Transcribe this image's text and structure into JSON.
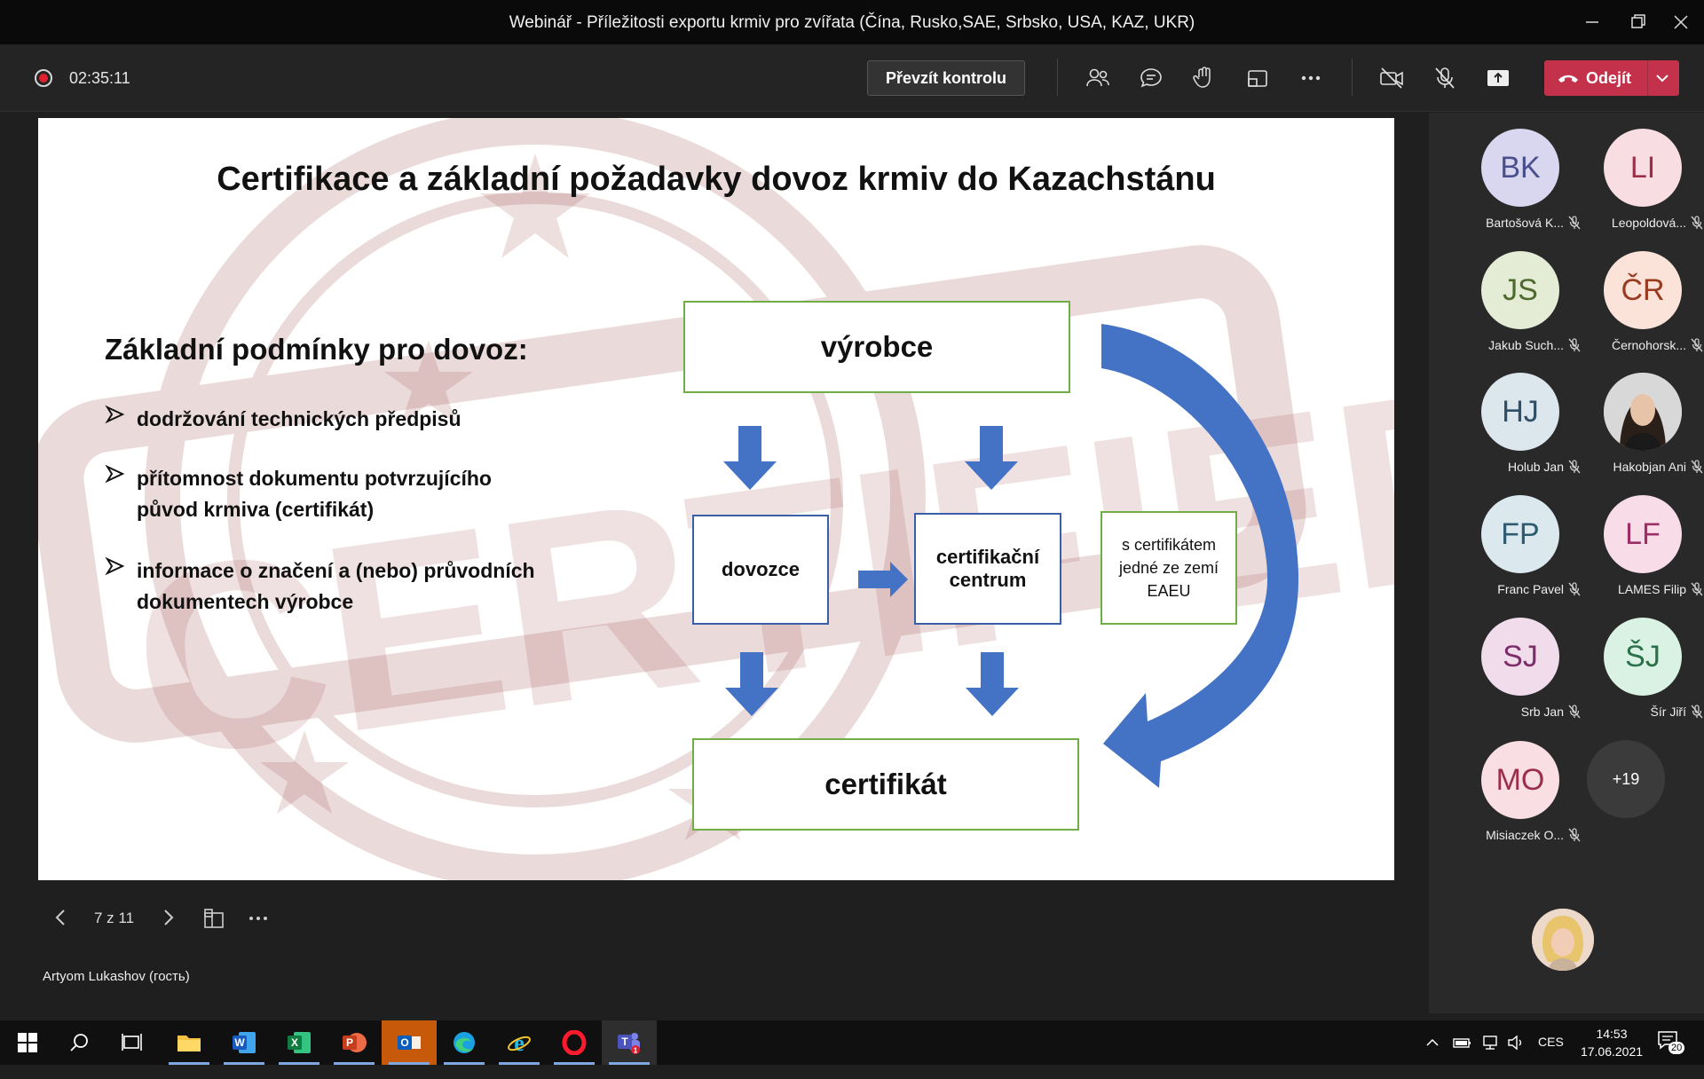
{
  "window": {
    "title": "Webinář - Příležitosti exportu krmiv pro zvířata (Čína, Rusko,SAE, Srbsko, USA, KAZ, UKR)"
  },
  "toolbar": {
    "timer": "02:35:11",
    "take_control_label": "Převzít kontrolu",
    "leave_label": "Odejít",
    "icons": [
      "people-icon",
      "chat-icon",
      "raise-hand-icon",
      "share-tray-icon",
      "more-icon",
      "camera-off-icon",
      "mic-off-icon",
      "share-icon"
    ]
  },
  "slide": {
    "title": "Certifikace a základní požadavky dovoz krmiv do Kazachstánu",
    "conditions_heading": "Základní podmínky pro dovoz:",
    "bullets": [
      " dodržování technických předpisů",
      "přítomnost dokumentu potvrzujícího původ krmiva (certifikát)",
      "informace o značení a (nebo) průvodních dokumentech výrobce"
    ],
    "watermark_text": "CERTIFIED",
    "diagram": {
      "producer": "výrobce",
      "importer": "dovozce",
      "cert_center": "certifikační centrum",
      "eaeu_note": "s certifikátem jedné ze zemí EAEU",
      "certificate": "certifikát"
    },
    "colors": {
      "green_border": "#70ad47",
      "blue_border": "#3a5fa8",
      "arrow_blue": "#4472c4"
    }
  },
  "slide_nav": {
    "page": "7 z 11"
  },
  "presenter": "Artyom Lukashov (гость)",
  "participants": [
    {
      "initials": "BK",
      "name": "Bartošová K...",
      "bg": "#d9d7ef",
      "fg": "#4a4f8e"
    },
    {
      "initials": "LI",
      "name": "Leopoldová...",
      "bg": "#f8dde3",
      "fg": "#9b2f49"
    },
    {
      "initials": "JS",
      "name": "Jakub Such...",
      "bg": "#e4ecd6",
      "fg": "#4f6a2e"
    },
    {
      "initials": "ČR",
      "name": "Černohorsk...",
      "bg": "#fbe3da",
      "fg": "#9a3a1f"
    },
    {
      "initials": "HJ",
      "name": "Holub Jan",
      "bg": "#dce6ed",
      "fg": "#2e4f66"
    },
    {
      "initials": "",
      "name": "Hakobjan Ani",
      "bg": "#cfcfcf",
      "fg": "#333333",
      "photo": true
    },
    {
      "initials": "FP",
      "name": "Franc Pavel",
      "bg": "#dbe9ef",
      "fg": "#2d5b70"
    },
    {
      "initials": "LF",
      "name": "LAMES Filip",
      "bg": "#f8dde9",
      "fg": "#9b2f66"
    },
    {
      "initials": "SJ",
      "name": "Srb Jan",
      "bg": "#f1dcec",
      "fg": "#7d2d6a"
    },
    {
      "initials": "ŠJ",
      "name": "Šír Jiří",
      "bg": "#d9f2e4",
      "fg": "#2a7048"
    },
    {
      "initials": "MO",
      "name": "Misiaczek O...",
      "bg": "#f9dee4",
      "fg": "#9b2f49"
    }
  ],
  "more_participants": "+19",
  "taskbar": {
    "apps": [
      "start-icon",
      "search-icon",
      "task-view-icon",
      "file-explorer-icon",
      "word-icon",
      "excel-icon",
      "powerpoint-icon",
      "outlook-icon",
      "edge-icon",
      "internet-explorer-icon",
      "opera-icon",
      "teams-icon"
    ],
    "language": "CES",
    "time": "14:53",
    "date": "17.06.2021",
    "notifications": "20"
  }
}
